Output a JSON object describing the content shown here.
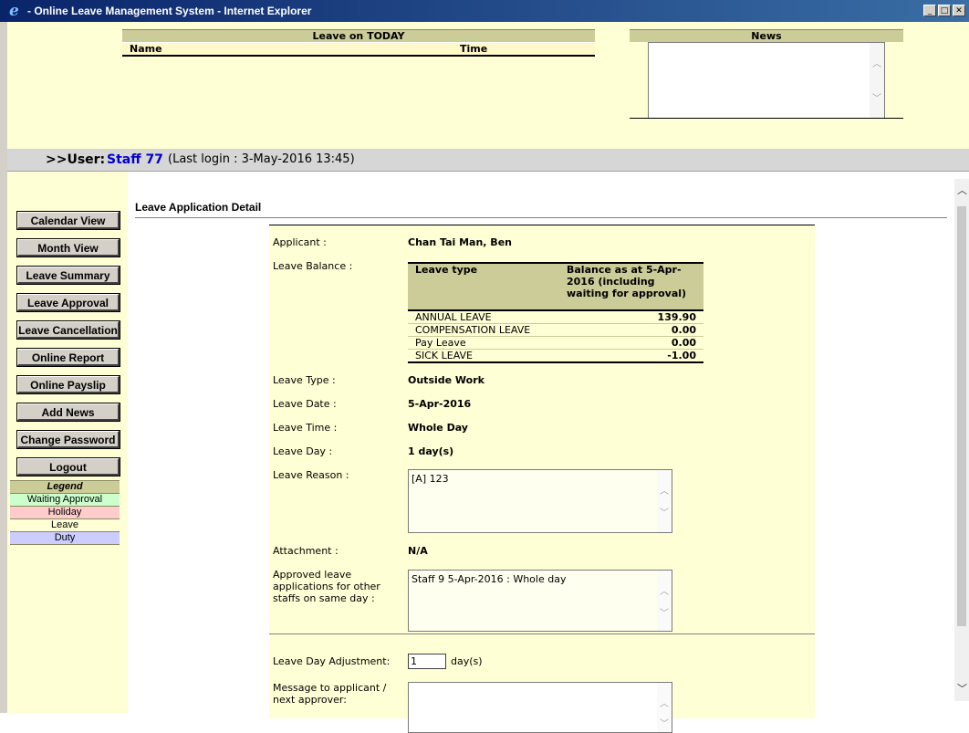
{
  "window": {
    "title": "- Online Leave Management System - Internet Explorer",
    "minimize": "_",
    "maximize": "□",
    "close": "✕"
  },
  "leave_today": {
    "title": "Leave on TODAY",
    "col_name": "Name",
    "col_time": "Time"
  },
  "news": {
    "title": "News"
  },
  "user": {
    "label": ">>User:",
    "name": "Staff 77",
    "last_login": "(Last login : 3-May-2016 13:45)"
  },
  "nav": [
    "Calendar View",
    "Month View",
    "Leave Summary",
    "Leave Approval",
    "Leave Cancellation",
    "Online Report",
    "Online Payslip",
    "Add News",
    "Change Password",
    "Logout"
  ],
  "legend": {
    "title": "Legend",
    "items": [
      {
        "label": "Waiting Approval",
        "color": "#ccffcc"
      },
      {
        "label": "Holiday",
        "color": "#ffcccc"
      },
      {
        "label": "Leave",
        "color": "#ffffd5"
      },
      {
        "label": "Duty",
        "color": "#ccccff"
      }
    ]
  },
  "page": {
    "title": "Leave Application Detail"
  },
  "form": {
    "applicant_label": "Applicant :",
    "applicant": "Chan Tai Man, Ben",
    "balance_label": "Leave Balance :",
    "balance_table": {
      "col_type": "Leave type",
      "col_balance": "Balance as at 5-Apr-2016 (including waiting for approval)",
      "rows": [
        {
          "type": "ANNUAL LEAVE",
          "balance": "139.90"
        },
        {
          "type": "COMPENSATION LEAVE",
          "balance": "0.00"
        },
        {
          "type": "Pay Leave",
          "balance": "0.00"
        },
        {
          "type": "SICK LEAVE",
          "balance": "-1.00"
        }
      ]
    },
    "type_label": "Leave Type :",
    "type": "Outside Work",
    "date_label": "Leave Date :",
    "date": "5-Apr-2016",
    "time_label": "Leave Time :",
    "time": "Whole Day",
    "day_label": "Leave Day :",
    "day": "1 day(s)",
    "reason_label": "Leave Reason :",
    "reason": "[A] 123",
    "attachment_label": "Attachment :",
    "attachment": "N/A",
    "approved_label": "Approved leave applications for other staffs on same day :",
    "approved": "Staff 9 5-Apr-2016 : Whole day",
    "adjust_label": "Leave Day Adjustment:",
    "adjust_value": "1",
    "adjust_unit": "day(s)",
    "message_label": "Message to applicant / next approver:",
    "message": ""
  }
}
